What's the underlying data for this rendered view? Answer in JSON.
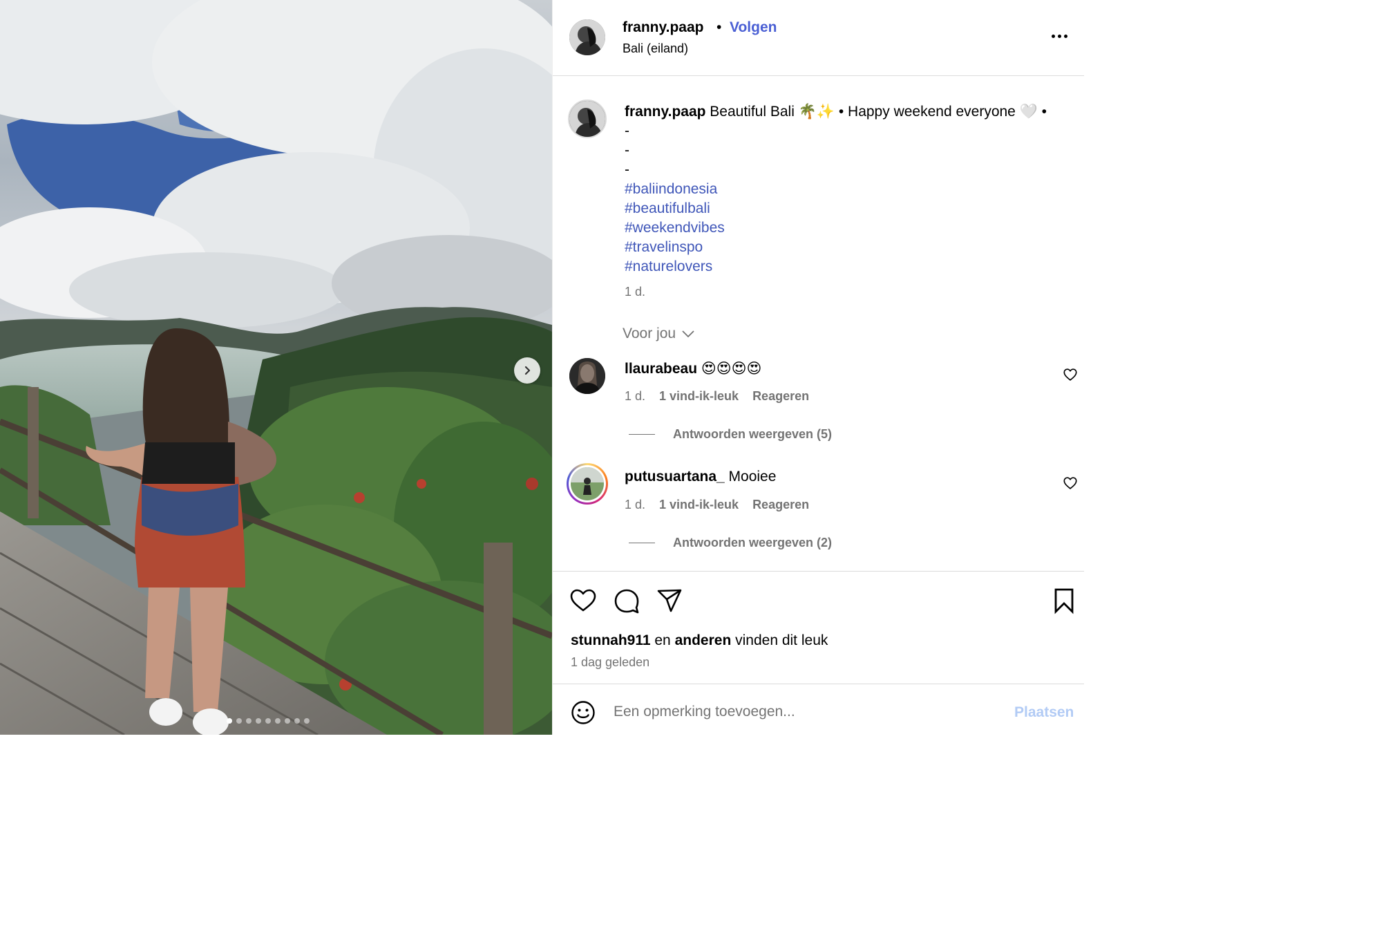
{
  "header": {
    "username": "franny.paap",
    "separator": "•",
    "follow_label": "Volgen",
    "location": "Bali (eiland)",
    "more_icon": "more-horizontal-icon"
  },
  "media": {
    "next_icon": "chevron-right-icon",
    "slide_count": 9,
    "active_slide": 1
  },
  "caption": {
    "username": "franny.paap",
    "text": " Beautiful Bali 🌴✨ • Happy weekend everyone 🤍 •",
    "dashes": [
      "-",
      "-",
      "-"
    ],
    "hashtags": [
      "#baliindonesia",
      "#beautifulbali",
      "#weekendvibes",
      "#travelinspo",
      "#naturelovers"
    ],
    "time": "1 d."
  },
  "sort": {
    "label": "Voor jou",
    "icon": "chevron-down-icon"
  },
  "comments": [
    {
      "username": "llaurabeau",
      "text": " 😍😍😍😍",
      "time": "1 d.",
      "likes": "1 vind-ik-leuk",
      "reply_label": "Reageren",
      "view_replies": "Antwoorden weergeven (5)"
    },
    {
      "username": "putusuartana_",
      "text": " Mooiee",
      "time": "1 d.",
      "likes": "1 vind-ik-leuk",
      "reply_label": "Reageren",
      "view_replies": "Antwoorden weergeven (2)"
    }
  ],
  "actions": {
    "liked_by_user": "stunnah911",
    "liked_by_joiner": " en ",
    "liked_by_others": "anderen",
    "liked_by_suffix": " vinden dit leuk",
    "post_time": "1 dag geleden"
  },
  "add_comment": {
    "placeholder": "Een opmerking toevoegen...",
    "post_label": "Plaatsen",
    "emoji_icon": "smiley-icon"
  },
  "colors": {
    "link_blue": "#4a5fd4",
    "hashtag_blue": "#3f56b8",
    "muted_gray": "#737373",
    "post_button_disabled": "#b2cbf5"
  }
}
